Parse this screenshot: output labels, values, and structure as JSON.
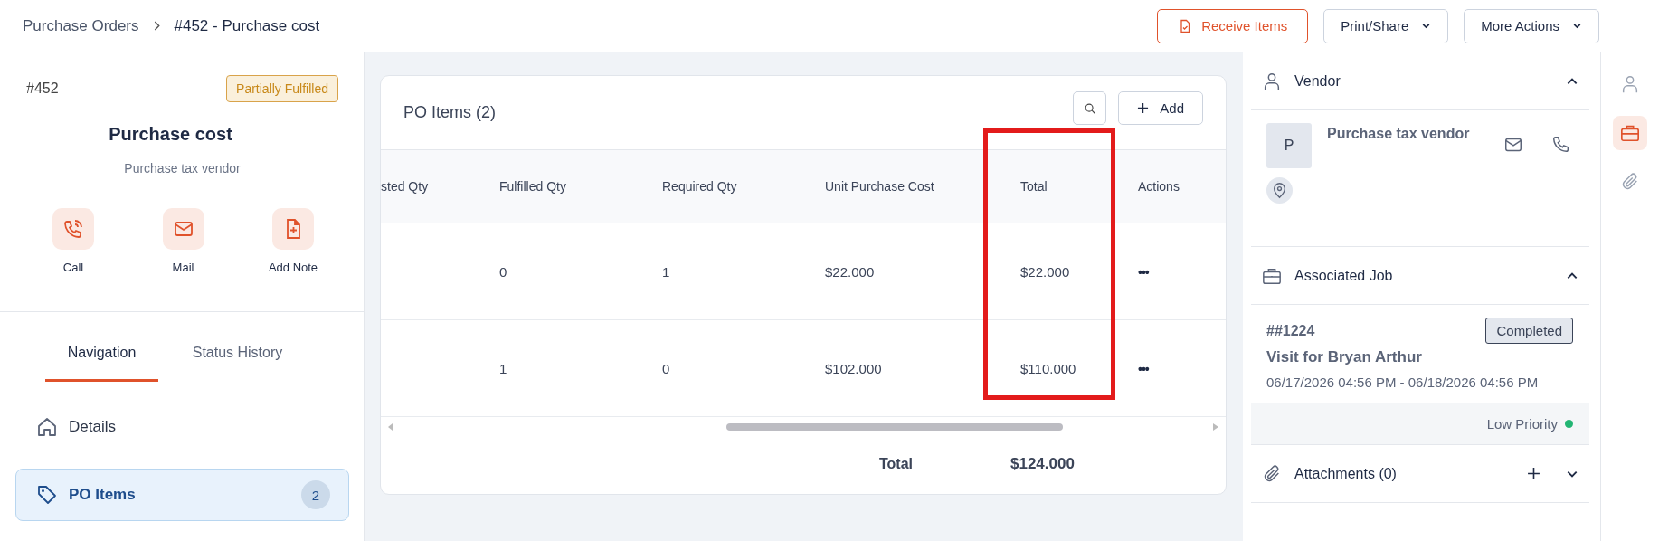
{
  "breadcrumb": {
    "parent": "Purchase Orders",
    "current": "#452 - Purchase cost"
  },
  "header_actions": [
    {
      "label": "Receive Items",
      "kind": "primary"
    },
    {
      "label": "Print/Share",
      "kind": "dropdown"
    },
    {
      "label": "More Actions",
      "kind": "dropdown"
    }
  ],
  "summary": {
    "number": "#452",
    "status": "Partially Fulfilled",
    "title": "Purchase cost",
    "vendor": "Purchase tax vendor",
    "actions": [
      {
        "label": "Call",
        "kind": "call"
      },
      {
        "label": "Mail",
        "kind": "mail"
      },
      {
        "label": "Add Note",
        "kind": "note"
      }
    ]
  },
  "tabs": [
    {
      "label": "Navigation",
      "selected": true
    },
    {
      "label": "Status History",
      "selected": false
    }
  ],
  "nav_items": [
    {
      "label": "Details",
      "kind": "home",
      "selected": false
    },
    {
      "label": "PO Items",
      "kind": "tag",
      "selected": true,
      "count": "2"
    }
  ],
  "po_items": {
    "title": "PO Items (2)",
    "add_label": "Add",
    "columns": [
      "sted Qty",
      "Fulfilled Qty",
      "Required Qty",
      "Unit Purchase Cost",
      "Total",
      "Actions"
    ],
    "rows": [
      {
        "fulfilled": "0",
        "required": "1",
        "unit_cost": "$22.000",
        "total": "$22.000",
        "actions": "•••"
      },
      {
        "fulfilled": "1",
        "required": "0",
        "unit_cost": "$102.000",
        "total": "$110.000",
        "actions": "•••"
      }
    ],
    "footer": {
      "label": "Total",
      "value": "$124.000"
    },
    "highlight_total_column": true
  },
  "vendor": {
    "title": "Vendor",
    "expanded": true,
    "initial": "P",
    "name": "Purchase tax vendor"
  },
  "associated_job": {
    "title": "Associated Job",
    "expanded": true,
    "number": "##1224",
    "status": "Completed",
    "name": "Visit for Bryan Arthur",
    "dates": "06/17/2026 04:56 PM - 06/18/2026 04:56 PM",
    "priority": {
      "label": "Low Priority",
      "color": "#22b573"
    }
  },
  "attachments": {
    "title": "Attachments (0)",
    "expanded": false
  },
  "rail": [
    {
      "kind": "person",
      "selected": false
    },
    {
      "kind": "briefcase",
      "selected": true
    },
    {
      "kind": "clip",
      "selected": false
    }
  ]
}
